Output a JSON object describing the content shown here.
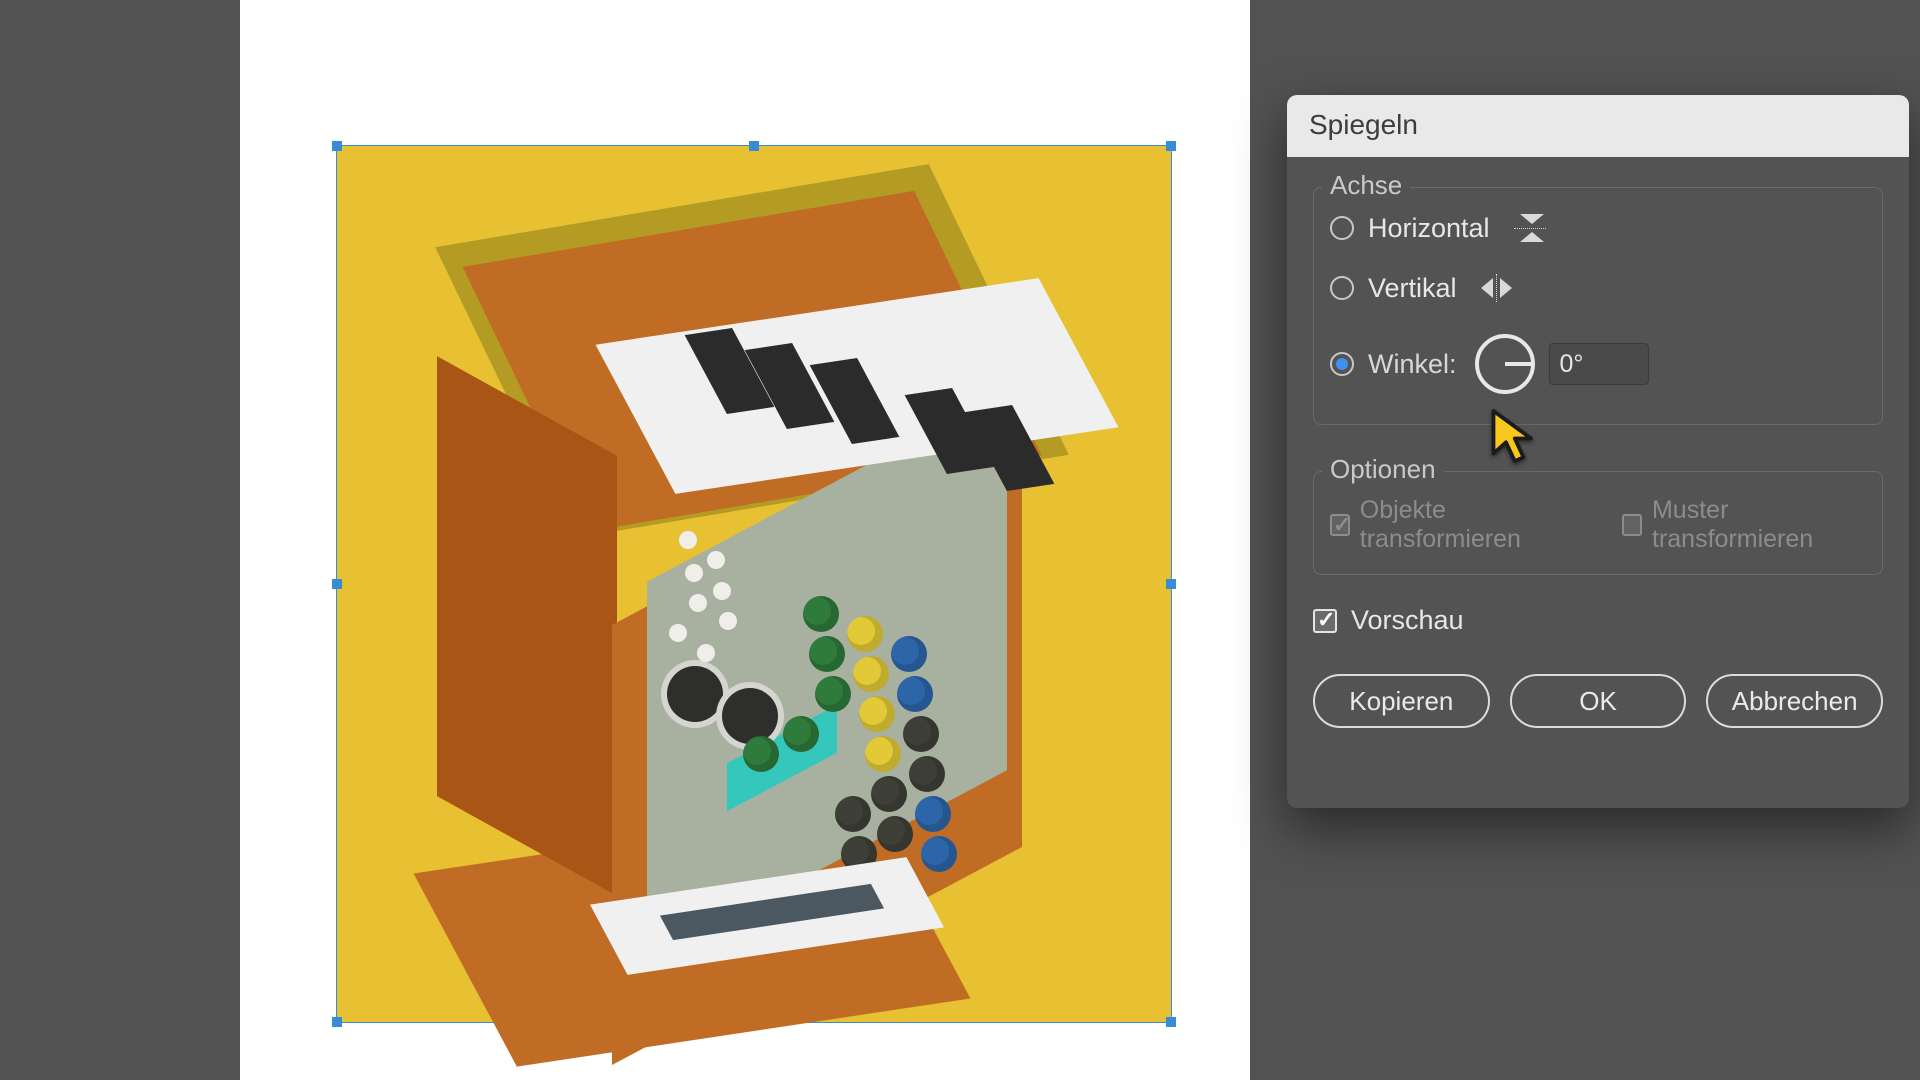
{
  "dialog": {
    "title": "Spiegeln",
    "axis": {
      "heading": "Achse",
      "horizontal_label": "Horizontal",
      "vertical_label": "Vertikal",
      "angle_label": "Winkel:",
      "angle_value": "0°",
      "selected": "angle"
    },
    "options": {
      "heading": "Optionen",
      "transform_objects_label": "Objekte transformieren",
      "transform_objects_checked": true,
      "transform_patterns_label": "Muster transformieren",
      "transform_patterns_checked": false
    },
    "preview": {
      "label": "Vorschau",
      "checked": true
    },
    "buttons": {
      "copy": "Kopieren",
      "ok": "OK",
      "cancel": "Abbrechen"
    }
  }
}
